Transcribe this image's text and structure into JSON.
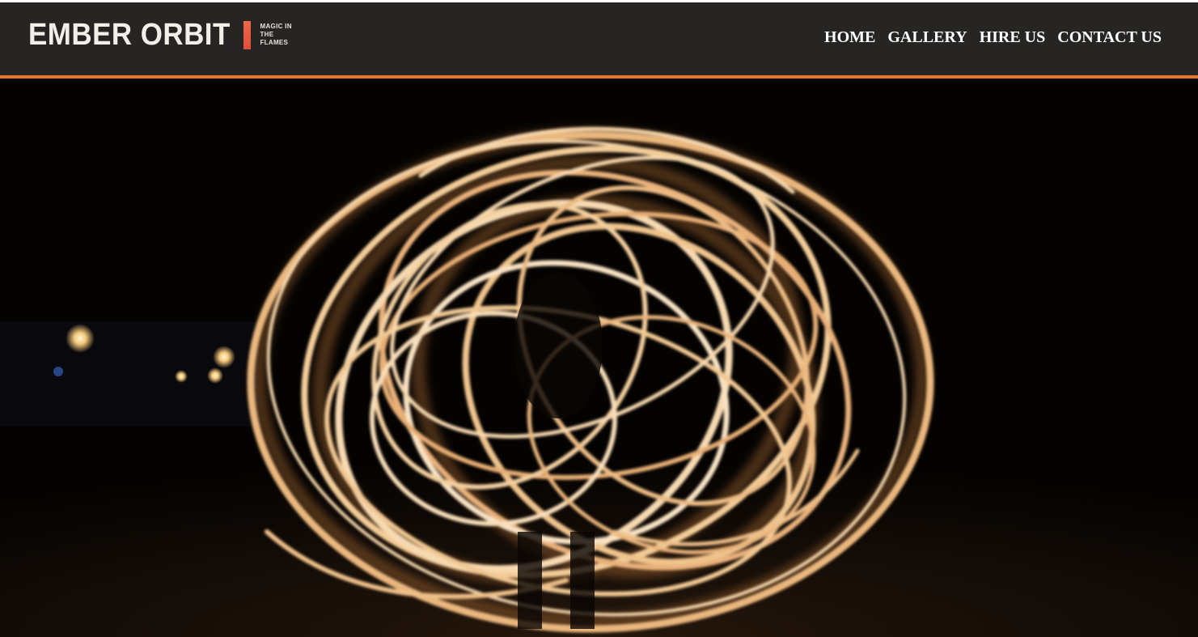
{
  "site": {
    "logo_name": "EMBER ORBIT",
    "tagline": "MAGIC IN THE FLAMES",
    "accent_color": "#e8752b"
  },
  "nav": {
    "items": [
      {
        "label": "HOME"
      },
      {
        "label": "GALLERY"
      },
      {
        "label": "HIRE US"
      },
      {
        "label": "CONTACT US"
      }
    ]
  },
  "hero": {
    "image": "fire-spinning-photo"
  }
}
